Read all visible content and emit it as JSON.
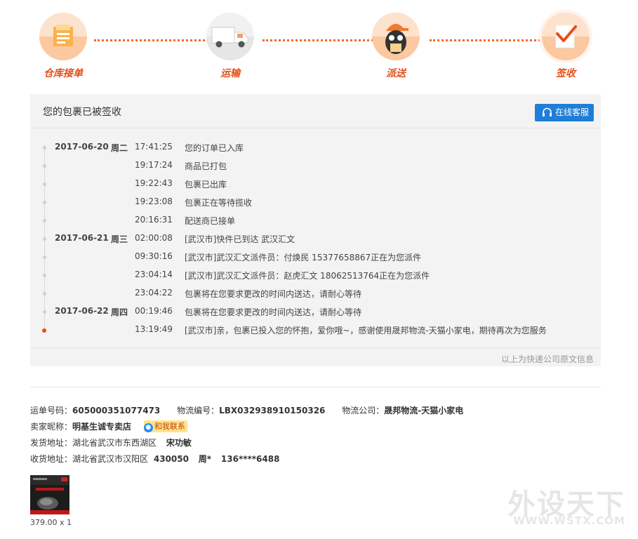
{
  "steps": [
    {
      "label": "仓库接单",
      "icon": "warehouse-doc-icon"
    },
    {
      "label": "运输",
      "icon": "truck-icon"
    },
    {
      "label": "派送",
      "icon": "courier-icon"
    },
    {
      "label": "签收",
      "icon": "signed-check-icon"
    }
  ],
  "panel": {
    "title": "您的包裹已被签收",
    "service_button": "在线客服",
    "footer_note": "以上为快递公司原文信息",
    "events": [
      {
        "date": "2017-06-20",
        "weekday": "周二",
        "time": "17:41:25",
        "desc": "您的订单已入库"
      },
      {
        "date": "",
        "weekday": "",
        "time": "19:17:24",
        "desc": "商品已打包"
      },
      {
        "date": "",
        "weekday": "",
        "time": "19:22:43",
        "desc": "包裹已出库"
      },
      {
        "date": "",
        "weekday": "",
        "time": "19:23:08",
        "desc": "包裹正在等待揽收"
      },
      {
        "date": "",
        "weekday": "",
        "time": "20:16:31",
        "desc": "配送商已接单"
      },
      {
        "date": "2017-06-21",
        "weekday": "周三",
        "time": "02:00:08",
        "desc": "[武汉市]快件已到达 武汉汇文"
      },
      {
        "date": "",
        "weekday": "",
        "time": "09:30:16",
        "desc": "[武汉市]武汉汇文派件员：付焕民 15377658867正在为您派件"
      },
      {
        "date": "",
        "weekday": "",
        "time": "23:04:14",
        "desc": "[武汉市]武汉汇文派件员：赵虎汇文 18062513764正在为您派件"
      },
      {
        "date": "",
        "weekday": "",
        "time": "23:04:22",
        "desc": "包裹将在您要求更改的时间内送达，请耐心等待"
      },
      {
        "date": "2017-06-22",
        "weekday": "周四",
        "time": "00:19:46",
        "desc": "包裹将在您要求更改的时间内送达，请耐心等待"
      },
      {
        "date": "",
        "weekday": "",
        "time": "13:19:49",
        "desc": "[武汉市]亲，包裹已投入您的怀抱，爱你哦~，感谢使用晟邦物流-天猫小家电，期待再次为您服务"
      }
    ]
  },
  "info": {
    "waybill_label": "运单号码：",
    "waybill": "605000351077473",
    "logistics_no_label": "物流编号：",
    "logistics_no": "LBX032938910150326",
    "company_label": "物流公司：",
    "company": "晟邦物流-天猫小家电",
    "seller_label": "卖家昵称：",
    "seller": "明基生诚专卖店",
    "contact": "和我联系",
    "ship_from_label": "发货地址：",
    "ship_from": "湖北省武汉市东西湖区",
    "ship_from_name": "宋功敏",
    "ship_to_label": "收货地址：",
    "ship_to": "湖北省武汉市汉阳区",
    "ship_to_zip": "430050",
    "ship_to_name": "周*",
    "ship_to_phone": "136****6488"
  },
  "product": {
    "price": "379.00 x 1"
  },
  "watermark": {
    "main": "外设天下",
    "url": "WWW.WSTX.COM"
  }
}
